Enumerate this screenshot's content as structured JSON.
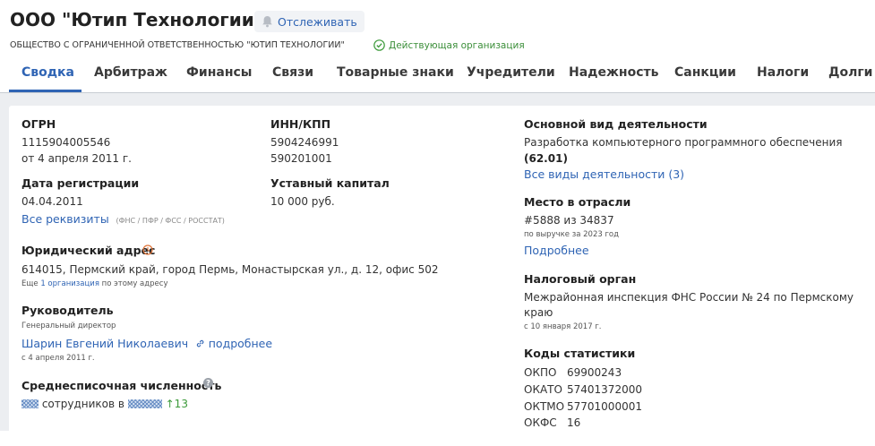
{
  "header": {
    "title": "ООО \"Ютип Технологии\"",
    "watch_label": "Отслеживать",
    "full_name": "ОБЩЕСТВО С ОГРАНИЧЕННОЙ ОТВЕТСТВЕННОСТЬЮ \"ЮТИП ТЕХНОЛОГИИ\"",
    "status": "Действующая организация"
  },
  "tabs": [
    {
      "label": "Сводка",
      "active": true
    },
    {
      "label": "Арбитраж"
    },
    {
      "label": "Финансы"
    },
    {
      "label": "Связи"
    },
    {
      "label": "Товарные знаки"
    },
    {
      "label": "Учредители"
    },
    {
      "label": "Надежность"
    },
    {
      "label": "Санкции"
    },
    {
      "label": "Налоги"
    },
    {
      "label": "Долги"
    }
  ],
  "ogrn": {
    "label": "ОГРН",
    "value": "1115904005546",
    "date": "от 4 апреля 2011 г."
  },
  "inn": {
    "label": "ИНН/КПП",
    "inn": "5904246991",
    "kpp": "590201001"
  },
  "registration": {
    "label": "Дата регистрации",
    "value": "04.04.2011",
    "all_link": "Все реквизиты",
    "sources": "(ФНС / ПФР / ФСС / РОССТАТ)"
  },
  "capital": {
    "label": "Уставный капитал",
    "value": "10 000 руб."
  },
  "address": {
    "label": "Юридический адрес",
    "value": "614015, Пермский край, город Пермь, Монастырская ул., д. 12, офис 502",
    "note_prefix": "Еще",
    "note_link": "1 организация",
    "note_suffix": "по этому адресу"
  },
  "director": {
    "label": "Руководитель",
    "position": "Генеральный директор",
    "name": "Шарин Евгений Николаевич",
    "more": "подробнее",
    "since": "с 4 апреля 2011 г."
  },
  "employees": {
    "label": "Среднесписочная численность",
    "text1": "сотрудников в",
    "delta": "↑13"
  },
  "activity": {
    "label": "Основной вид деятельности",
    "value": "Разработка компьютерного программного обеспечения",
    "code": "(62.01)",
    "all_link": "Все виды деятельности (3)"
  },
  "rank": {
    "label": "Место в отрасли",
    "value": "#5888 из 34837",
    "note": "по выручке за 2023 год",
    "more": "Подробнее"
  },
  "tax": {
    "label": "Налоговый орган",
    "line1": "Межрайонная инспекция ФНС России № 24 по Пермскому",
    "line2": "краю",
    "since": "с 10 января 2017 г."
  },
  "stats": {
    "label": "Коды статистики",
    "rows": [
      {
        "name": "ОКПО",
        "code": "69900243"
      },
      {
        "name": "ОКАТО",
        "code": "57401372000"
      },
      {
        "name": "ОКТМО",
        "code": "57701000001"
      },
      {
        "name": "ОКФС",
        "code": "16"
      }
    ]
  }
}
